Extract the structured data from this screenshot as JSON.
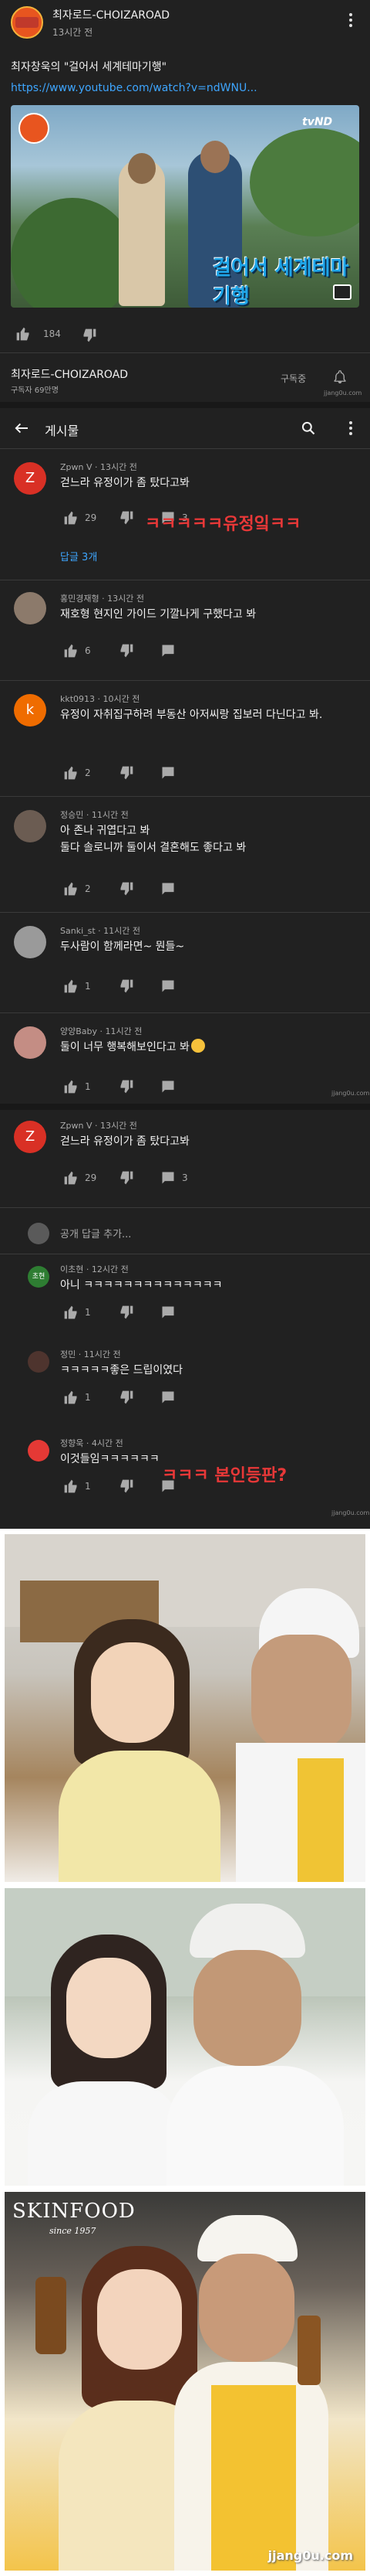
{
  "post": {
    "channel_name": "최자로드-CHOIZAROAD",
    "time": "13시간 전",
    "text": "최자창욱의 \"걸어서 세계테마기행\"",
    "link": "https://www.youtube.com/watch?v=ndWNU...",
    "video": {
      "overlay_title": "걸어서 세계테마기행",
      "logo": "tvND"
    },
    "likes": "184"
  },
  "channel": {
    "name": "최자로드-CHOIZAROAD",
    "subscribers": "구독자 69만명",
    "subscribed_label": "구독중"
  },
  "nav": {
    "title": "게시물"
  },
  "comments": [
    {
      "initial": "Z",
      "color": "#d93025",
      "author_time": "Zpwn V · 13시간 전",
      "text": "걷느라 유정이가 좀 탔다고봐",
      "likes": "29",
      "replies": "3"
    },
    {
      "initial": "",
      "color": "#8c7a6b",
      "author_time": "홍민경재형 · 13시간 전",
      "text": "재호형 현지인 가이드 기깔나게 구했다고 봐",
      "likes": "6",
      "replies": ""
    },
    {
      "initial": "k",
      "color": "#ef6c00",
      "author_time": "kkt0913 · 10시간 전",
      "text": "유정이 자취집구하려 부동산 아저씨랑 집보러 다닌다고 봐.",
      "likes": "2",
      "replies": ""
    },
    {
      "initial": "",
      "color": "#6b5c52",
      "author_time": "정승민 · 11시간 전",
      "text": "아 존나 귀엽다고 봐\n둘다 솔로니까 둘이서 결혼해도 좋다고 봐",
      "likes": "2",
      "replies": ""
    },
    {
      "initial": "",
      "color": "#9a9a9a",
      "author_time": "Sanki_st · 11시간 전",
      "text": "두사람이 함께라면~ 뭔들~",
      "likes": "1",
      "replies": ""
    },
    {
      "initial": "",
      "color": "#c48d84",
      "author_time": "양양Baby · 11시간 전",
      "text": "둘이 너무 행복해보인다고 봐",
      "likes": "1",
      "replies": ""
    }
  ],
  "thread": {
    "original": {
      "initial": "Z",
      "color": "#d93025",
      "author_time": "Zpwn V · 13시간 전",
      "text": "걷느라 유정이가 좀 탔다고봐",
      "likes": "29",
      "replies": "3"
    },
    "reply_count_label": "답글 3개",
    "add_reply_placeholder": "공개 답글 추가...",
    "replies": [
      {
        "initial": "초현",
        "color": "#2e7d32",
        "author_time": "이초현 · 12시간 전",
        "text": "아니 ㅋㅋㅋㅋㅋㅋㅋㅋㅋㅋㅋㅋㅋㅋ",
        "likes": "1"
      },
      {
        "initial": "",
        "color": "#4e342e",
        "author_time": "정민 · 11시간 전",
        "text": "ㅋㅋㅋㅋㅋ좋은 드립이였다",
        "likes": "1"
      },
      {
        "initial": "",
        "color": "#e53935",
        "author_time": "정향욱 · 4시간 전",
        "text": "이것들임ㅋㅋㅋㅋㅋㅋ",
        "likes": "1"
      }
    ]
  },
  "annotations": {
    "note1": "ㅋㅋㅋㅋㅋ유정잌ㅋㅋ",
    "note2": "ㅋㅋㅋ 본인등판?"
  },
  "watermarks": {
    "small": "jjang0u.com",
    "photo": "jjang0u.com"
  },
  "photos": {
    "brand": "SKINFOOD",
    "brand_sub": "since 1957"
  },
  "colors": {
    "background": "#212121",
    "link": "#3ea6ff",
    "note": "#e83838"
  }
}
